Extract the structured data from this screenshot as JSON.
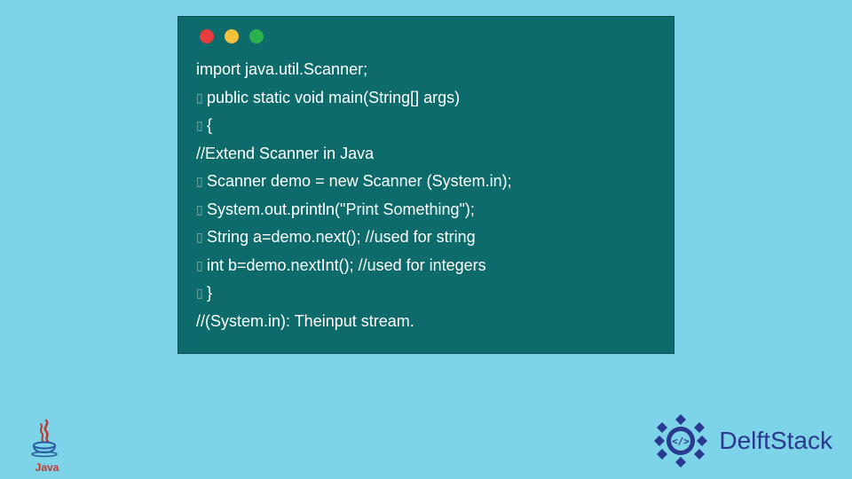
{
  "code": {
    "lines": [
      {
        "text": "import java.util.Scanner;",
        "indent": false
      },
      {
        "text": "public static void main(String[] args)",
        "indent": true
      },
      {
        "text": "{",
        "indent": true
      },
      {
        "text": "//Extend Scanner in Java",
        "indent": false
      },
      {
        "text": "Scanner demo = new Scanner (System.in);",
        "indent": true
      },
      {
        "text": "System.out.println(\"Print Something\");",
        "indent": true
      },
      {
        "text": "String a=demo.next(); //used for string",
        "indent": true
      },
      {
        "text": "int b=demo.nextInt(); //used for integers",
        "indent": true
      },
      {
        "text": "}",
        "indent": true
      },
      {
        "text": "//(System.in): Theinput stream.",
        "indent": false
      }
    ]
  },
  "logos": {
    "java_label": "Java",
    "delft_label": "DelftStack"
  },
  "window": {
    "dot_colors": {
      "red": "#e83b3b",
      "yellow": "#f3c13a",
      "green": "#2bb24c"
    }
  }
}
